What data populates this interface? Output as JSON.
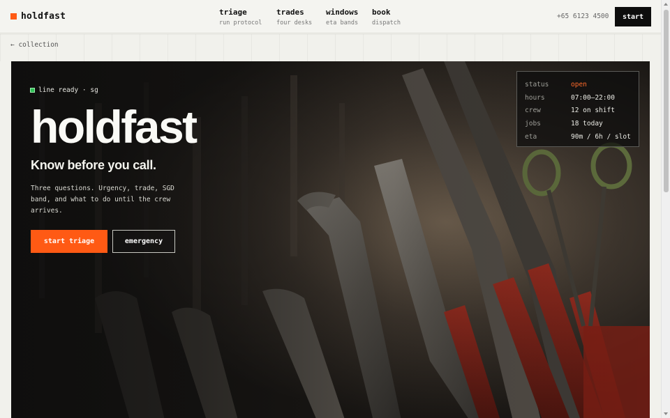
{
  "brand": {
    "name": "holdfast",
    "mark_color": "#ff5a14"
  },
  "nav": {
    "items": [
      {
        "label": "triage",
        "sub": "run protocol"
      },
      {
        "label": "trades",
        "sub": "four desks"
      },
      {
        "label": "windows",
        "sub": "eta bands"
      },
      {
        "label": "book",
        "sub": "dispatch"
      }
    ]
  },
  "header": {
    "phone": "+65 6123 4500",
    "start_label": "start"
  },
  "subbar": {
    "back_label": "← collection"
  },
  "hero": {
    "status": "line ready · sg",
    "title": "holdfast",
    "tagline": "Know before you call.",
    "description": "Three questions. Urgency, trade, SGD band, and what to do until the crew arrives.",
    "primary_button": "start triage",
    "secondary_button": "emergency",
    "accent_color": "#ff5a14",
    "status_color": "#2fbf55"
  },
  "info_panel": {
    "rows": [
      {
        "key": "status",
        "value": "open"
      },
      {
        "key": "hours",
        "value": "07:00–22:00"
      },
      {
        "key": "crew",
        "value": "12 on shift"
      },
      {
        "key": "jobs",
        "value": "18 today"
      },
      {
        "key": "eta",
        "value": "90m / 6h / slot"
      }
    ]
  }
}
